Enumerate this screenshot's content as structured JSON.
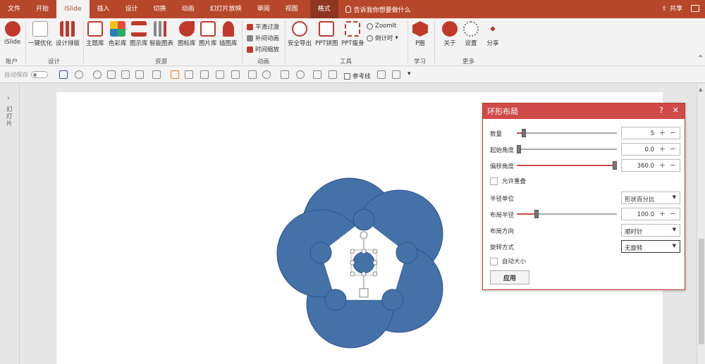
{
  "tabs": [
    {
      "label": "文件",
      "name": "tab-file"
    },
    {
      "label": "开始",
      "name": "tab-home"
    },
    {
      "label": "iSlide",
      "name": "tab-islide",
      "active": true
    },
    {
      "label": "插入",
      "name": "tab-insert"
    },
    {
      "label": "设计",
      "name": "tab-design"
    },
    {
      "label": "切换",
      "name": "tab-transitions"
    },
    {
      "label": "动画",
      "name": "tab-animations"
    },
    {
      "label": "幻灯片放映",
      "name": "tab-slideshow"
    },
    {
      "label": "审阅",
      "name": "tab-review"
    },
    {
      "label": "视图",
      "name": "tab-view"
    }
  ],
  "format_tab": "格式",
  "tell_me": "告诉我你想要做什么",
  "share": "共享",
  "ribbon": {
    "buttons": {
      "islide": "iSlide",
      "one_key": "一键优化",
      "design_layout": "设计排版",
      "theme_lib": "主题库",
      "color_lib": "色彩库",
      "diagram_lib": "图示库",
      "smart_chart": "智能图表",
      "icon_lib": "图标库",
      "image_lib": "图片库",
      "illustration_lib": "插图库",
      "smooth_transition": "平滑过渡",
      "tween": "补间动画",
      "time_zoom": "时间缩放",
      "safe_export": "安全导出",
      "ppt_collage": "PPT拼图",
      "ppt_slim": "PPT瘦身",
      "zoomit": "ZoomIt",
      "countdown": "倒计时",
      "p_circle": "P圈",
      "about": "关于",
      "settings": "设置",
      "share": "分享"
    },
    "groups": {
      "account": "账户",
      "design": "设计",
      "resources": "资源",
      "animation": "动画",
      "tools": "工具",
      "learn": "学习",
      "more": "更多"
    }
  },
  "quick": {
    "autosave": "自动保存",
    "guides": "参考线"
  },
  "left_pane": "幻灯片",
  "dialog": {
    "title": "环形布局",
    "help": "?",
    "close": "✕",
    "count": {
      "label": "数量",
      "value": "5",
      "fraction": 0.07
    },
    "start_angle": {
      "label": "起始角度",
      "value": "0.0",
      "fraction": 0.0
    },
    "offset_angle": {
      "label": "偏移角度",
      "value": "360.0",
      "fraction": 1.0
    },
    "allow_overlap": {
      "label": "允许重叠",
      "checked": false
    },
    "radius_unit": {
      "label": "半径单位",
      "value": "形状百分比"
    },
    "layout_radius": {
      "label": "布局半径",
      "value": "100.0",
      "fraction": 0.2
    },
    "direction": {
      "label": "布局方向",
      "value": "顺时针"
    },
    "rotation": {
      "label": "旋转方式",
      "value": "无旋转"
    },
    "auto_size": {
      "label": "自动大小",
      "checked": false
    },
    "apply": "应用"
  },
  "colors": {
    "accent": "#b7472a",
    "dialog_accent": "#d04a4a",
    "shape_fill": "#4472a8",
    "shape_stroke": "#2f528f"
  }
}
